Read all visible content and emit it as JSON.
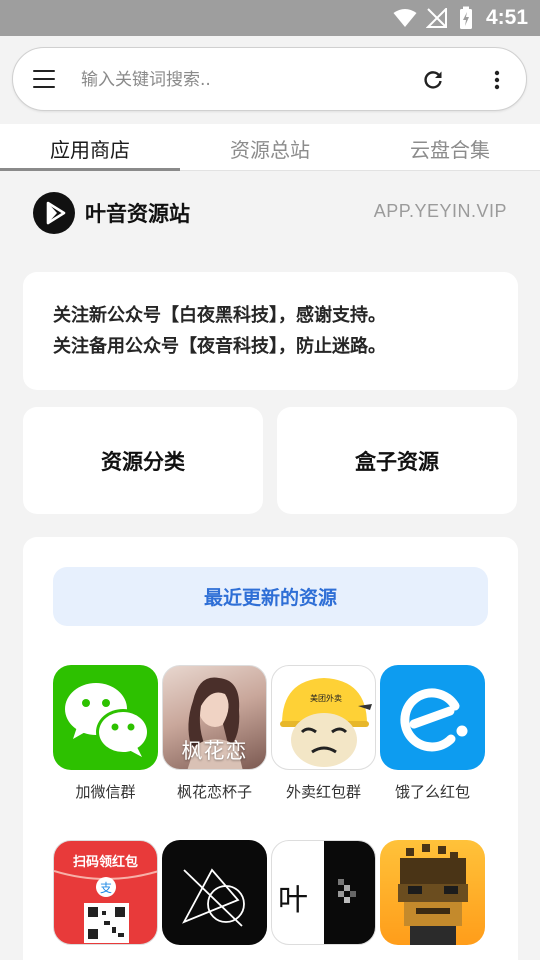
{
  "status_bar": {
    "time": "4:51"
  },
  "search": {
    "placeholder": "输入关键词搜索.."
  },
  "tabs": [
    {
      "label": "应用商店"
    },
    {
      "label": "资源总站"
    },
    {
      "label": "云盘合集"
    }
  ],
  "brand": {
    "name": "叶音资源站",
    "url": "APP.YEYIN.VIP"
  },
  "notice": {
    "line1": "关注新公众号【白夜黑科技】，感谢支持。",
    "line2": "关注备用公众号【夜音科技】，防止迷路。"
  },
  "quick_links": {
    "left": "资源分类",
    "right": "盒子资源"
  },
  "recent": {
    "title": "最近更新的资源",
    "apps": [
      {
        "label": "加微信群",
        "icon": "wechat-icon"
      },
      {
        "label": "枫花恋杯子",
        "icon": "photo-icon",
        "overlay_text": "枫花恋"
      },
      {
        "label": "外卖红包群",
        "icon": "meme-face-icon",
        "badge_text": "美团外卖"
      },
      {
        "label": "饿了么红包",
        "icon": "eleme-icon"
      },
      {
        "label": "",
        "icon": "red-packet-icon",
        "title_text": "扫码领红包"
      },
      {
        "label": "",
        "icon": "geometric-logo-icon"
      },
      {
        "label": "",
        "icon": "yeyin-icon",
        "glyph": "叶"
      },
      {
        "label": "",
        "icon": "pixel-avatar-icon"
      }
    ]
  },
  "colors": {
    "accent_blue": "#2f6fd6",
    "wechat_green": "#2dc100",
    "eleme_blue": "#0d9cf0",
    "red_packet": "#e83a3a",
    "meituan_yellow": "#fed136"
  }
}
